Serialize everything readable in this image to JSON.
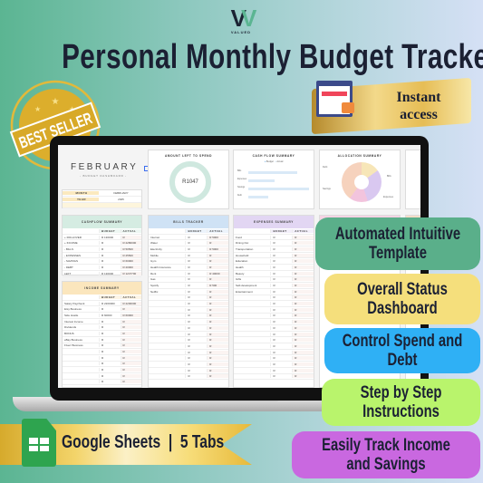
{
  "brand": {
    "logo_text": "VALUED VIRTUAL"
  },
  "title": "Personal Monthly Budget Tracker",
  "badge": {
    "text": "BEST SELLER"
  },
  "ribbon": {
    "text_line1": "Instant",
    "text_line2": "access"
  },
  "features": [
    "Automated Intuitive Template",
    "Overall Status Dashboard",
    "Control Spend and Debt",
    "Step by Step Instructions",
    "Easily Track Income and Savings"
  ],
  "feature_colors": [
    "#5aaf8a",
    "#f5df7c",
    "#2fb0f5",
    "#b9f46c",
    "#c968e0"
  ],
  "platform": {
    "text": "Google Sheets  |  5 Tabs",
    "icon": "google-sheets-icon"
  },
  "sheet": {
    "month_title": "FEBRUARY",
    "subtitle": "- BUDGET DASHBOARD -",
    "month_label": "MONTH",
    "month_value": "FEBRUARY",
    "year_label": "YEAR",
    "year_value": "2025",
    "amount_left": {
      "title": "AMOUNT LEFT TO SPEND",
      "value": "R1047"
    },
    "cashflow_chart": {
      "title": "CASH FLOW SUMMARY",
      "legend": [
        "Budget",
        "Actual"
      ],
      "categories": [
        "Bills",
        "Expenses",
        "Savings",
        "Debt"
      ],
      "budget": [
        0,
        0,
        0,
        0
      ],
      "actual": [
        0.8,
        0.42,
        0.98,
        0.33
      ]
    },
    "allocation": {
      "title": "ALLOCATION SUMMARY",
      "labels": [
        "Debt",
        "Bills",
        "Expenses",
        "Savings"
      ],
      "values": [
        15,
        30,
        15,
        40
      ],
      "colors": [
        "#f7e6b8",
        "#d9c8f0",
        "#f2c4dd",
        "#f6d2bd"
      ]
    },
    "cashflow": {
      "title": "CASHFLOW SUMMARY",
      "headers": [
        "",
        "BUDGET",
        "ACTUAL"
      ],
      "rows": [
        [
          "+ ROLLOVER",
          "R 130000",
          "R"
        ],
        [
          "+ INCOME",
          "R",
          "R 2280000"
        ],
        [
          "- BILLS",
          "R",
          "R 50500"
        ],
        [
          "- EXPENSES",
          "R",
          "R 25500"
        ],
        [
          "- SAVINGS",
          "R",
          "R 60000"
        ],
        [
          "- DEBT",
          "R",
          "R 20000"
        ],
        [
          "LEFT",
          "R 130000",
          "R 1247700"
        ]
      ]
    },
    "bills": {
      "title": "BILLS TRACKER",
      "headers": [
        "",
        "BUDGET",
        "ACTUAL"
      ],
      "rows": [
        [
          "Internet",
          "R",
          "R 5000"
        ],
        [
          "Water",
          "R",
          "R"
        ],
        [
          "Electricity",
          "R",
          "R 5000"
        ],
        [
          "Mobile",
          "R",
          "R"
        ],
        [
          "Gym",
          "R",
          "R"
        ],
        [
          "Health Insurance",
          "R",
          "R"
        ],
        [
          "Rent",
          "R",
          "R 40000"
        ],
        [
          "Gas",
          "R",
          "R"
        ],
        [
          "Spotify",
          "R",
          "R 500"
        ],
        [
          "Netflix",
          "R",
          "R"
        ],
        [
          "",
          "R",
          "R"
        ],
        [
          "",
          "R",
          "R"
        ],
        [
          "",
          "R",
          "R"
        ],
        [
          "",
          "R",
          "R"
        ],
        [
          "",
          "R",
          "R"
        ],
        [
          "",
          "R",
          "R"
        ],
        [
          "",
          "R",
          "R"
        ],
        [
          "",
          "R",
          "R"
        ],
        [
          "",
          "R",
          "R"
        ],
        [
          "",
          "R",
          "R"
        ],
        [
          "",
          "R",
          "R"
        ],
        [
          "",
          "R",
          "R"
        ],
        [
          "",
          "R",
          "R"
        ],
        [
          "",
          "R",
          "R"
        ]
      ]
    },
    "income": {
      "title": "INCOME SUMMARY",
      "headers": [
        "",
        "BUDGET",
        "ACTUAL"
      ],
      "rows": [
        [
          "Salary Paycheck",
          "R 2200000",
          "R 2200000"
        ],
        [
          "Etsy Business",
          "R",
          "R"
        ],
        [
          "Side Hustle",
          "R 60000",
          "R 60000"
        ],
        [
          "Interest Income",
          "R",
          "R"
        ],
        [
          "Dividends",
          "R",
          "R"
        ],
        [
          "BONUS",
          "R",
          "R"
        ],
        [
          "eBay Business",
          "R",
          "R"
        ],
        [
          "Fiverr Business",
          "R",
          "R"
        ],
        [
          "",
          "R",
          "R"
        ],
        [
          "",
          "R",
          "R"
        ],
        [
          "",
          "R",
          "R"
        ],
        [
          "",
          "R",
          "R"
        ],
        [
          "",
          "R",
          "R"
        ],
        [
          "",
          "R",
          "R"
        ]
      ]
    },
    "expenses": {
      "title": "EXPENSES SUMMARY",
      "headers": [
        "",
        "BUDGET",
        "ACTUAL"
      ],
      "rows": [
        [
          "Food",
          "R",
          "R"
        ],
        [
          "Dining Out",
          "R",
          "R"
        ],
        [
          "Transportation",
          "R",
          "R"
        ],
        [
          "Household",
          "R",
          "R"
        ],
        [
          "Education",
          "R",
          "R"
        ],
        [
          "Health",
          "R",
          "R"
        ],
        [
          "Beauty",
          "R",
          "R"
        ],
        [
          "Gifts",
          "R",
          "R"
        ],
        [
          "Self-development",
          "R",
          "R"
        ],
        [
          "Entertainment",
          "R",
          "R"
        ],
        [
          "",
          "R",
          "R"
        ],
        [
          "",
          "R",
          "R"
        ],
        [
          "",
          "R",
          "R"
        ],
        [
          "",
          "R",
          "R"
        ],
        [
          "",
          "R",
          "R"
        ],
        [
          "",
          "R",
          "R"
        ],
        [
          "",
          "R",
          "R"
        ],
        [
          "",
          "R",
          "R"
        ],
        [
          "",
          "R",
          "R"
        ],
        [
          "",
          "R",
          "R"
        ],
        [
          "",
          "R",
          "R"
        ],
        [
          "",
          "R",
          "R"
        ],
        [
          "",
          "R",
          "R"
        ],
        [
          "",
          "R",
          "R"
        ]
      ]
    }
  }
}
